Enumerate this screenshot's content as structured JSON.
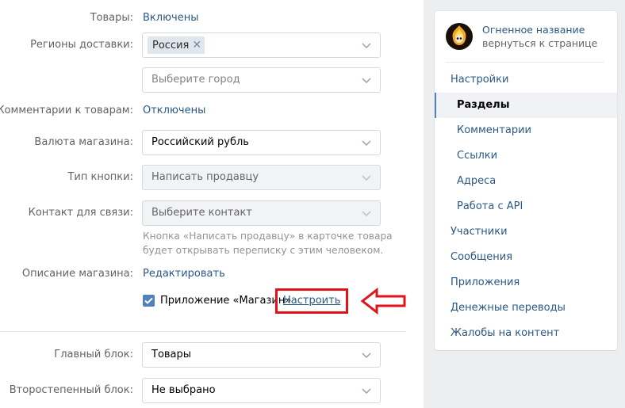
{
  "form": {
    "goods": {
      "label": "Товары:",
      "value": "Включены"
    },
    "delivery_regions": {
      "label": "Регионы доставки:",
      "tag": "Россия",
      "tag_remove": "✕"
    },
    "city": {
      "placeholder": "Выберите город"
    },
    "comments": {
      "label": "Комментарии к товарам:",
      "value": "Отключены"
    },
    "currency": {
      "label": "Валюта магазина:",
      "value": "Российский рубль"
    },
    "button_type": {
      "label": "Тип кнопки:",
      "value": "Написать продавцу"
    },
    "contact": {
      "label": "Контакт для связи:",
      "placeholder": "Выберите контакт"
    },
    "hint": "Кнопка «Написать продавцу» в карточке товара будет открывать переписку с этим человеком.",
    "description": {
      "label": "Описание магазина:",
      "value": "Редактировать"
    },
    "app_shop": {
      "label": "Приложение «Магазин»",
      "checked": true,
      "configure": "Настроить"
    },
    "main_block": {
      "label": "Главный блок:",
      "value": "Товары"
    },
    "secondary_block": {
      "label": "Второстепенный блок:",
      "value": "Не выбрано"
    }
  },
  "sidebar": {
    "group_name": "Огненное название",
    "back_link": "вернуться к странице",
    "items": [
      {
        "label": "Настройки",
        "level": "top"
      },
      {
        "label": "Разделы",
        "level": "sub",
        "active": true
      },
      {
        "label": "Комментарии",
        "level": "sub"
      },
      {
        "label": "Ссылки",
        "level": "sub"
      },
      {
        "label": "Адреса",
        "level": "sub"
      },
      {
        "label": "Работа с API",
        "level": "sub"
      },
      {
        "label": "Участники",
        "level": "top"
      },
      {
        "label": "Сообщения",
        "level": "top"
      },
      {
        "label": "Приложения",
        "level": "top"
      },
      {
        "label": "Денежные переводы",
        "level": "top"
      },
      {
        "label": "Жалобы на контент",
        "level": "top"
      }
    ]
  },
  "colors": {
    "link": "#2a5885",
    "accent": "#5181b8",
    "highlight": "#e0131a"
  },
  "icons": {
    "dropdown": "chevron-down-icon",
    "arrow": "left-arrow-icon",
    "check": "check-icon"
  }
}
